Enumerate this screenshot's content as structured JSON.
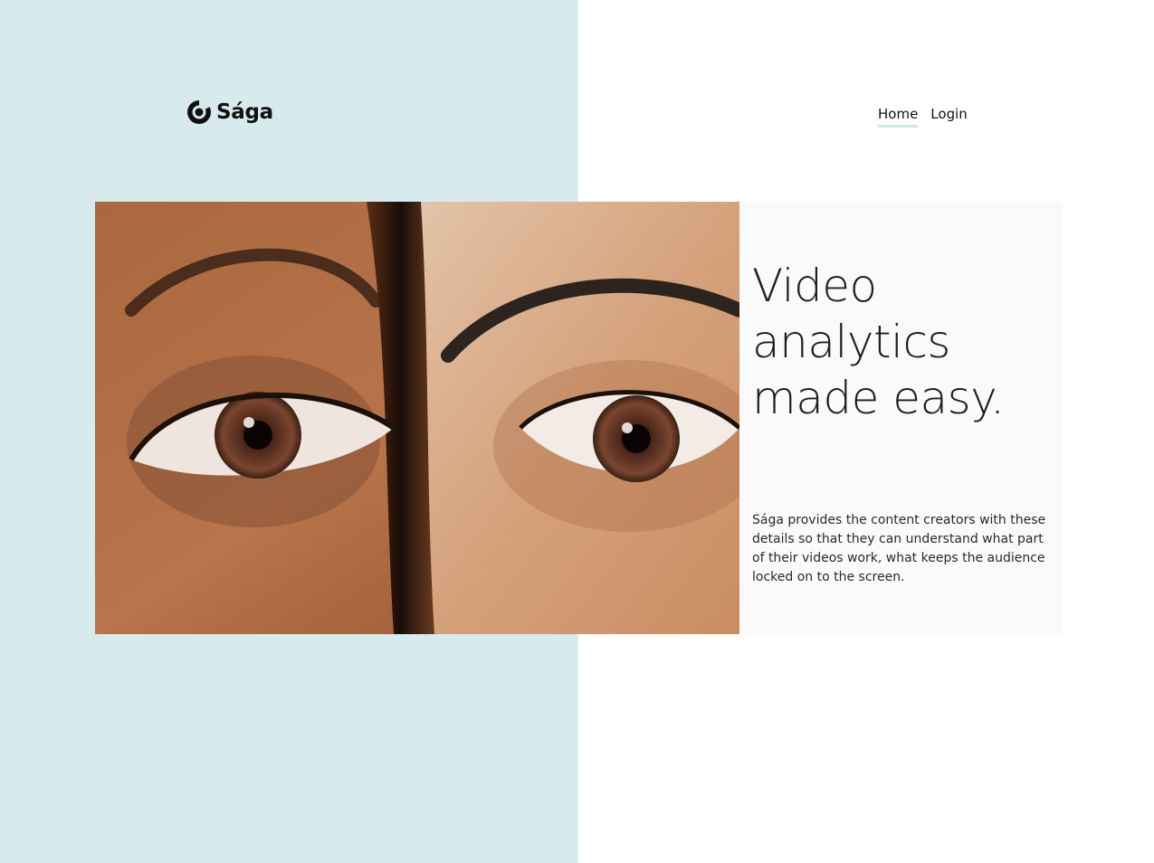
{
  "brand": {
    "name": "Sága",
    "logo_icon": "eye-logo-icon"
  },
  "nav": {
    "items": [
      {
        "label": "Home",
        "active": true
      },
      {
        "label": "Login",
        "active": false
      }
    ]
  },
  "hero": {
    "image_alt": "Close-up of two faces side by side showing one brown eye each",
    "headline_lines": [
      "Video",
      "analytics",
      "made easy."
    ],
    "description": "Sága provides the content creators with these details so that they can understand what part of their videos work, what keeps the audience locked on to the screen."
  },
  "colors": {
    "left_panel": "#d7eaee",
    "background": "#ffffff",
    "card": "#fafafa",
    "nav_underline": "#cfe6ea",
    "text": "#1c1c1c"
  }
}
